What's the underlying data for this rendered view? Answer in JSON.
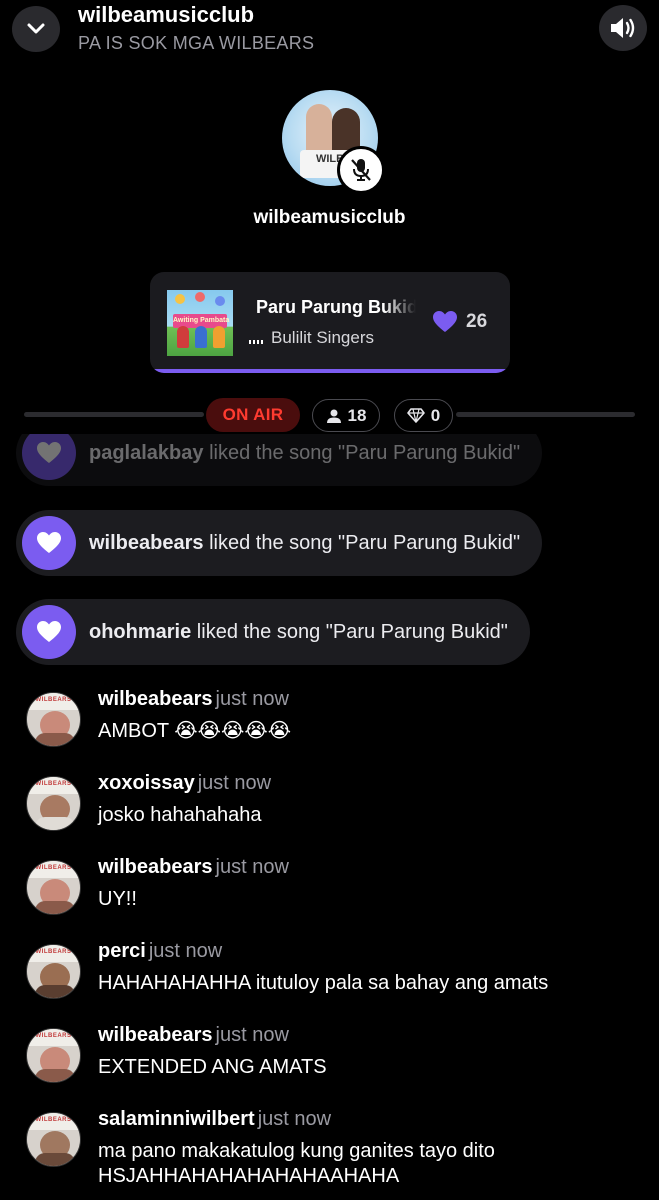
{
  "header": {
    "room_name": "wilbeamusicclub",
    "room_description": "PA IS SOK MGA WILBEARS"
  },
  "host": {
    "name": "wilbeamusicclub",
    "avatar_caption": "WILB",
    "muted": true
  },
  "now_playing": {
    "title": "Paru Parung Bukid",
    "artist": "Bulilit Singers",
    "likes": "26",
    "cover_caption": "Awiting Pambata"
  },
  "status": {
    "on_air_label": "ON AIR",
    "listeners": "18",
    "diamonds": "0"
  },
  "events": [
    {
      "user": "paglalakbay",
      "text": " liked the song \"Paru Parung Bukid\""
    },
    {
      "user": "wilbeabears",
      "text": " liked the song \"Paru Parung Bukid\""
    },
    {
      "user": "ohohmarie",
      "text": " liked the song \"Paru Parung Bukid\""
    }
  ],
  "comments": [
    {
      "user": "wilbeabears",
      "time": "just now",
      "message": "AMBOT 😭😭😭😭😭",
      "avatar_band": "WILBEARS"
    },
    {
      "user": "xoxoissay",
      "time": "just now",
      "message": "josko hahahahaha",
      "avatar_band": "WILBEARS"
    },
    {
      "user": "wilbeabears",
      "time": "just now",
      "message": "UY!!",
      "avatar_band": "WILBEARS"
    },
    {
      "user": "perci",
      "time": "just now",
      "message": "HAHAHAHAHHA itutuloy pala sa bahay ang amats",
      "avatar_band": "WILBEARS"
    },
    {
      "user": "wilbeabears",
      "time": "just now",
      "message": "EXTENDED ANG AMATS",
      "avatar_band": "WILBEARS"
    },
    {
      "user": "salaminniwilbert",
      "time": "just now",
      "message": "ma pano makakatulog kung ganites tayo dito HSJAHHAHAHAHAHAHAAHAHA",
      "avatar_band": "WILBEARS"
    }
  ],
  "colors": {
    "accent_purple": "#7b5cf0",
    "on_air_red": "#ff3b30",
    "background": "#000000"
  }
}
